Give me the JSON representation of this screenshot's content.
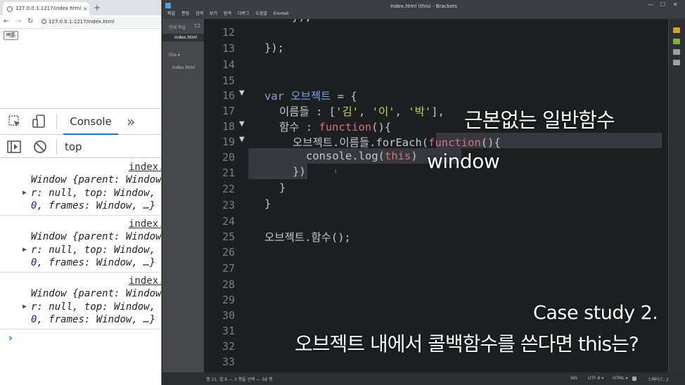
{
  "browser": {
    "tab_title": "127.0.0.1:1217/index.html",
    "tab_close": "×",
    "new_tab": "+",
    "url": "127.0.0.1:1217/index.html",
    "page_button": "버튼"
  },
  "devtools": {
    "console_tab": "Console",
    "more": "»",
    "context": "top",
    "entries": [
      {
        "source": "index.",
        "line1": "Window {parent: Window",
        "line2": "r: null, top: Window,",
        "line3_num": "0",
        "line3_rest": ", frames: Window, …}"
      },
      {
        "source": "index.",
        "line1": "Window {parent: Window",
        "line2": "r: null, top: Window,",
        "line3_num": "0",
        "line3_rest": ", frames: Window, …}"
      },
      {
        "source": "index.",
        "line1": "Window {parent: Window",
        "line2": "r: null, top: Window,",
        "line3_num": "0",
        "line3_rest": ", frames: Window, …}"
      }
    ],
    "prompt": "›"
  },
  "editor": {
    "window_title": "index.html (this) - Brackets",
    "menus": [
      "파일",
      "편집",
      "검색",
      "보기",
      "탐색",
      "디버그",
      "도움말",
      "Emmet"
    ],
    "sidebar": {
      "working_files": "현재 파일",
      "active_file": "index.html",
      "folder": "this ▾",
      "tree_file": "index.html"
    },
    "gutter": [
      "12",
      "13",
      "14",
      "15",
      "16",
      "17",
      "18",
      "19",
      "20",
      "21",
      "22",
      "23",
      "24",
      "25",
      "26",
      "27",
      "28",
      "29",
      "30",
      "31",
      "32",
      "33"
    ],
    "code": {
      "l12": "});",
      "l13": "});",
      "l16_kw": "var",
      "l16_name": "오브젝트",
      "l16_rest": " = {",
      "l17_key": "이름들 : [",
      "l17_s1": "'김'",
      "l17_s2": "'이'",
      "l17_s3": "'박'",
      "l17_end": "],",
      "l18_key": "함수 : ",
      "l18_fn": "function",
      "l18_end": "(){",
      "l19_a": "오브젝트.이름들.forEach(",
      "l19_fn": "function",
      "l19_end": "(){",
      "l20_a": "console.log(",
      "l20_this": "this",
      "l20_end": ")",
      "l21": "})",
      "l22": "}",
      "l23": "}",
      "l25": "오브젝트.함수();"
    },
    "status": {
      "cursor": "행 21, 열 8 — 3 행을 선택 — 58 행",
      "ins": "INS",
      "encoding": "UTF-8 ▾",
      "language": "HTML ▾",
      "spaces": "스페이스: 2"
    }
  },
  "captions": {
    "normal_function": "근본없는 일반함수",
    "window": "window",
    "case_study": "Case study 2.",
    "question": "오브젝트 내에서 콜백함수를 쓴다면 this는?"
  },
  "colors": {
    "keyword": "#8fa1d3",
    "variable": "#74a8e8",
    "function": "#d46f7f",
    "string": "#c9d05c",
    "editor_bg": "#1d1f21"
  }
}
